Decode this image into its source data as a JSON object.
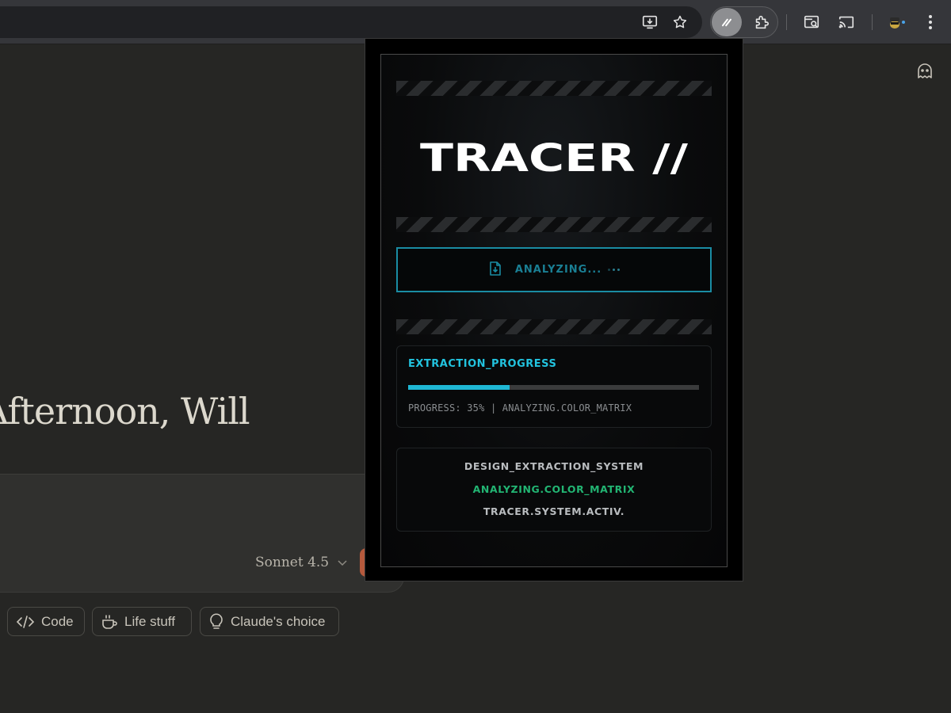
{
  "browser": {
    "icons": [
      "install-app-icon",
      "bookmark-star-icon",
      "tracer-extension-icon",
      "extensions-puzzle-icon",
      "search-tab-icon",
      "cast-icon",
      "profile-avatar",
      "more-menu-icon"
    ]
  },
  "page": {
    "greeting": "Afternoon, Will",
    "model_label": "Sonnet 4.5",
    "chips": [
      {
        "label": "Code",
        "icon": "code-icon"
      },
      {
        "label": "Life stuff",
        "icon": "coffee-cup-icon"
      },
      {
        "label": "Claude's choice",
        "icon": "lightbulb-icon"
      }
    ]
  },
  "tracer": {
    "logo_text": "TRACER //",
    "analyze_button_label": "ANALYZING...",
    "progress": {
      "title": "EXTRACTION_PROGRESS",
      "percent": 35,
      "status_text": "PROGRESS: 35% | ANALYZING.COLOR_MATRIX"
    },
    "system": {
      "line1": "DESIGN_EXTRACTION_SYSTEM",
      "line2": "ANALYZING.COLOR_MATRIX",
      "line3": "TRACER.SYSTEM.ACTIV."
    }
  },
  "colors": {
    "accent_cyan": "#22c3df",
    "accent_green": "#22b573",
    "page_bg": "#262624",
    "send_button": "#b5593c"
  }
}
